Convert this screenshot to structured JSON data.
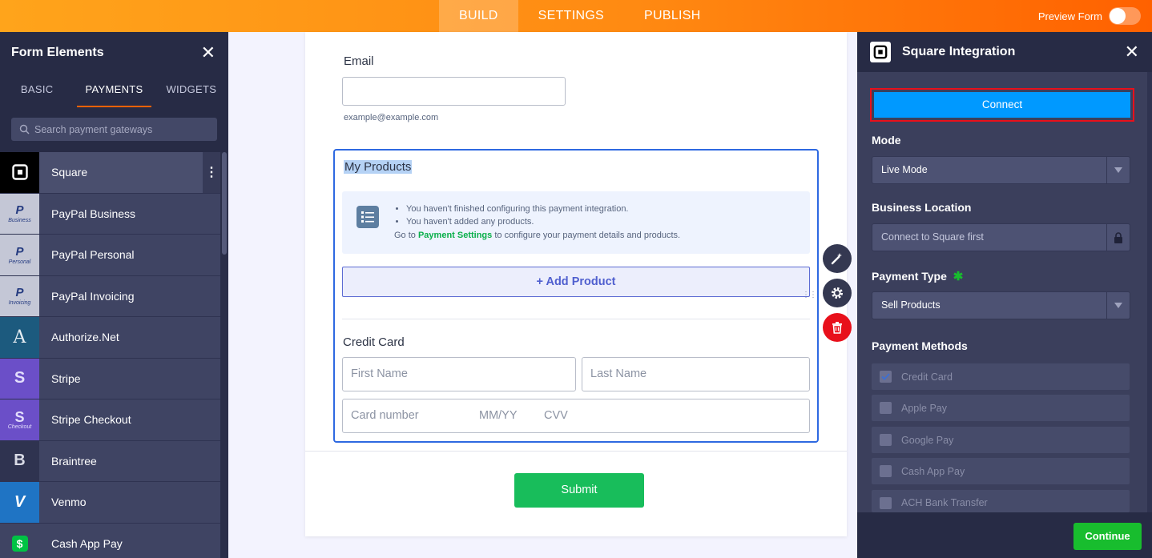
{
  "topbar": {
    "tabs": [
      "BUILD",
      "SETTINGS",
      "PUBLISH"
    ],
    "preview_label": "Preview Form"
  },
  "left_panel": {
    "title": "Form Elements",
    "tabs": [
      "BASIC",
      "PAYMENTS",
      "WIDGETS"
    ],
    "search_placeholder": "Search payment gateways",
    "items": [
      {
        "label": "Square",
        "icon": "square-logo-icon"
      },
      {
        "label": "PayPal Business",
        "icon": "paypal-business-icon",
        "sub": "Business"
      },
      {
        "label": "PayPal Personal",
        "icon": "paypal-personal-icon",
        "sub": "Personal"
      },
      {
        "label": "PayPal Invoicing",
        "icon": "paypal-invoicing-icon",
        "sub": "Invoicing"
      },
      {
        "label": "Authorize.Net",
        "icon": "authorize-net-icon",
        "glyph": "A"
      },
      {
        "label": "Stripe",
        "icon": "stripe-icon",
        "glyph": "S"
      },
      {
        "label": "Stripe Checkout",
        "icon": "stripe-checkout-icon",
        "glyph": "S",
        "sub": "Checkout"
      },
      {
        "label": "Braintree",
        "icon": "braintree-icon",
        "glyph": "B"
      },
      {
        "label": "Venmo",
        "icon": "venmo-icon",
        "glyph": "V"
      },
      {
        "label": "Cash App Pay",
        "icon": "cash-app-icon",
        "glyph": "$"
      }
    ]
  },
  "form": {
    "email_label": "Email",
    "email_sublabel": "example@example.com",
    "products_title": "My Products",
    "notice_items": [
      "You haven't finished configuring this payment integration.",
      "You haven't added any products."
    ],
    "notice_goto_prefix": "Go to",
    "notice_goto_link": "Payment Settings",
    "notice_goto_suffix": "to configure your payment details and products.",
    "add_product": "+ Add Product",
    "credit_card_label": "Credit Card",
    "first_name_placeholder": "First Name",
    "last_name_placeholder": "Last Name",
    "card_number_placeholder": "Card number",
    "mmyy_placeholder": "MM/YY",
    "cvv_placeholder": "CVV",
    "submit_label": "Submit"
  },
  "right_panel": {
    "title": "Square Integration",
    "connect_label": "Connect",
    "mode_label": "Mode",
    "mode_value": "Live Mode",
    "business_location_label": "Business Location",
    "business_location_value": "Connect to Square first",
    "payment_type_label": "Payment Type",
    "payment_type_value": "Sell Products",
    "payment_methods_label": "Payment Methods",
    "payment_methods": [
      {
        "label": "Credit Card",
        "checked": true
      },
      {
        "label": "Apple Pay",
        "checked": false
      },
      {
        "label": "Google Pay",
        "checked": false
      },
      {
        "label": "Cash App Pay",
        "checked": false
      },
      {
        "label": "ACH Bank Transfer",
        "checked": false
      }
    ],
    "continue_label": "Continue"
  },
  "colors": {
    "accent_orange": "#ff6100",
    "connect_blue": "#0099ff",
    "submit_green": "#18bd5b",
    "delete_red": "#e8101b"
  }
}
